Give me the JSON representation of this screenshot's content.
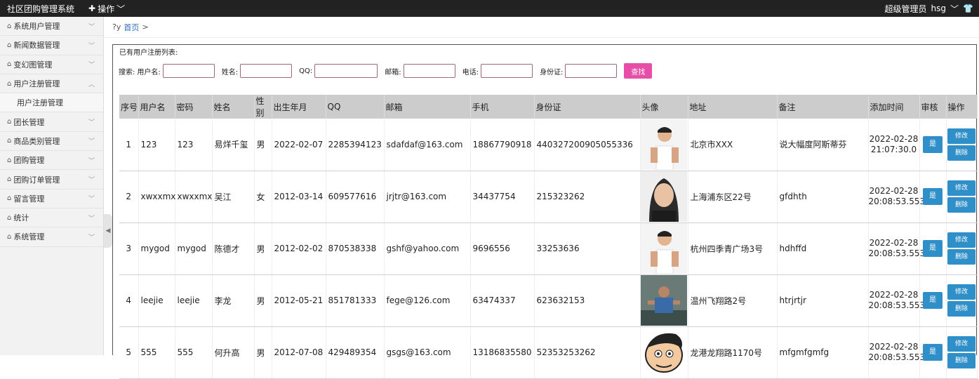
{
  "topbar": {
    "app_title": "社区团购管理系统",
    "op_menu": "操作",
    "user": "超级管理员",
    "username": "hsg"
  },
  "sidebar": {
    "items": [
      {
        "label": "系统用户管理",
        "chevron": "﹀"
      },
      {
        "label": "新闻数据管理",
        "chevron": "﹀"
      },
      {
        "label": "变幻图管理",
        "chevron": "﹀"
      },
      {
        "label": "用户注册管理",
        "chevron": "︿"
      },
      {
        "label": "用户注册管理",
        "sub": true
      },
      {
        "label": "团长管理",
        "chevron": "﹀"
      },
      {
        "label": "商品类别管理",
        "chevron": "﹀"
      },
      {
        "label": "团购管理",
        "chevron": "﹀"
      },
      {
        "label": "团购订单管理",
        "chevron": "﹀"
      },
      {
        "label": "留言管理",
        "chevron": "﹀"
      },
      {
        "label": "统计",
        "chevron": "﹀"
      },
      {
        "label": "系统管理",
        "chevron": "﹀"
      }
    ]
  },
  "breadcrumb": {
    "prefix": "?y",
    "home": "首页",
    "sep": ">"
  },
  "panel": {
    "title": "已有用户注册列表:"
  },
  "search": {
    "prefix": "搜索:",
    "username_label": "用户名:",
    "name_label": "姓名:",
    "qq_label": "QQ:",
    "email_label": "邮箱:",
    "phone_label": "电话:",
    "idcard_label": "身份证:",
    "button": "查找"
  },
  "table": {
    "headers": [
      "序号",
      "用户名",
      "密码",
      "姓名",
      "性别",
      "出生年月",
      "QQ",
      "邮箱",
      "手机",
      "身份证",
      "头像",
      "地址",
      "备注",
      "添加时间",
      "审核",
      "操作"
    ],
    "rows": [
      {
        "no": "1",
        "username": "123",
        "password": "123",
        "name": "易烊千玺",
        "gender": "男",
        "birth": "2022-02-07",
        "qq": "2285394123",
        "email": "sdafdaf@163.com",
        "phone": "18867790918",
        "idcard": "440327200905055336",
        "address": "北京市XXX",
        "note": "说大幅度阿斯蒂芬",
        "date": "2022-02-28",
        "time": "21:07:30.0",
        "audit": "是",
        "edit": "修改",
        "del": "删除",
        "avatar": "man-white-shirt"
      },
      {
        "no": "2",
        "username": "xwxxmx",
        "password": "xwxxmx",
        "name": "吴江",
        "gender": "女",
        "birth": "2012-03-14",
        "qq": "609577616",
        "email": "jrjtr@163.com",
        "phone": "34437754",
        "idcard": "215323262",
        "address": "上海浦东区22号",
        "note": "gfdhth",
        "date": "2022-02-28",
        "time": "20:08:53.553",
        "audit": "是",
        "edit": "修改",
        "del": "删除",
        "avatar": "woman-portrait"
      },
      {
        "no": "3",
        "username": "mygod",
        "password": "mygod",
        "name": "陈德才",
        "gender": "男",
        "birth": "2012-02-02",
        "qq": "870538338",
        "email": "gshf@yahoo.com",
        "phone": "9696556",
        "idcard": "33253636",
        "address": "杭州四季青广场3号",
        "note": "hdhffd",
        "date": "2022-02-28",
        "time": "20:08:53.553",
        "audit": "是",
        "edit": "修改",
        "del": "删除",
        "avatar": "man-white-shirt"
      },
      {
        "no": "4",
        "username": "leejie",
        "password": "leejie",
        "name": "李龙",
        "gender": "男",
        "birth": "2012-05-21",
        "qq": "851781333",
        "email": "fege@126.com",
        "phone": "63474337",
        "idcard": "623632153",
        "address": "温州飞翔路2号",
        "note": "htrjrtjr",
        "date": "2022-02-28",
        "time": "20:08:53.553",
        "audit": "是",
        "edit": "修改",
        "del": "删除",
        "avatar": "gym-man"
      },
      {
        "no": "5",
        "username": "555",
        "password": "555",
        "name": "何升高",
        "gender": "男",
        "birth": "2012-07-08",
        "qq": "429489354",
        "email": "gsgs@163.com",
        "phone": "13186835580",
        "idcard": "52353253262",
        "address": "龙港龙翔路1170号",
        "note": "mfgmfgmfg",
        "date": "2022-02-28",
        "time": "20:08:53.553",
        "audit": "是",
        "edit": "修改",
        "del": "删除",
        "avatar": "cartoon-face"
      }
    ]
  }
}
